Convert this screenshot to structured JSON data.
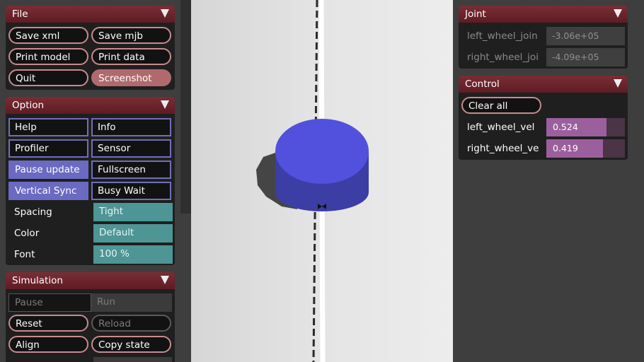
{
  "file_panel": {
    "title": "File",
    "buttons": [
      "Save xml",
      "Save mjb",
      "Print model",
      "Print data",
      "Quit",
      "Screenshot"
    ]
  },
  "option_panel": {
    "title": "Option",
    "checks": [
      "Help",
      "Info",
      "Profiler",
      "Sensor",
      "Pause update",
      "Fullscreen",
      "Vertical Sync",
      "Busy Wait"
    ],
    "checks_on": [
      "Pause update",
      "Vertical Sync"
    ],
    "spacing": {
      "label": "Spacing",
      "value": "Tight"
    },
    "color": {
      "label": "Color",
      "value": "Default"
    },
    "font": {
      "label": "Font",
      "value": "100 %"
    }
  },
  "simulation_panel": {
    "title": "Simulation",
    "pause": "Pause",
    "run": "Run",
    "reset": "Reset",
    "reload": "Reload",
    "align": "Align",
    "copy_state": "Copy state"
  },
  "joint_panel": {
    "title": "Joint",
    "joints": [
      {
        "label": "left_wheel_join",
        "value": "-3.06e+05"
      },
      {
        "label": "right_wheel_joi",
        "value": "-4.09e+05"
      }
    ]
  },
  "control_panel": {
    "title": "Control",
    "clear_all": "Clear all",
    "controls": [
      {
        "label": "left_wheel_vel",
        "value": "0.524",
        "fraction": 0.77
      },
      {
        "label": "right_wheel_ve",
        "value": "0.419",
        "fraction": 0.72
      }
    ]
  },
  "colors": {
    "header": "#6b242c",
    "button_border": "#c88b8f",
    "checkbox_on": "#6a6ac2",
    "select": "#4e9595",
    "slider": "#9c5f9e",
    "cylinder": "#5555dd"
  }
}
